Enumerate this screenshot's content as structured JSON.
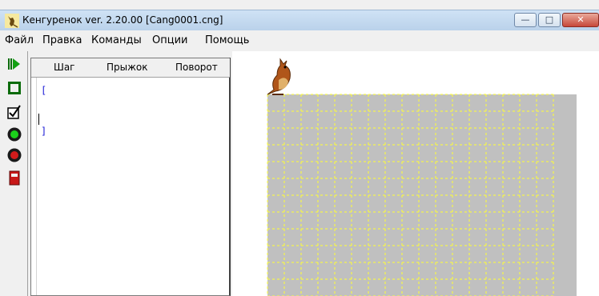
{
  "window": {
    "title": "Кенгуренок ver. 2.20.00  [Cang0001.cng]",
    "controls": {
      "minimize": "—",
      "maximize": "□",
      "close": "✕"
    }
  },
  "menu": [
    {
      "label": "Файл"
    },
    {
      "label": "Правка"
    },
    {
      "label": "Команды"
    },
    {
      "label": "Опции"
    },
    {
      "label": "Помощь"
    }
  ],
  "toolbar": {
    "items": [
      {
        "icon": "run-icon"
      },
      {
        "icon": "stop-square-icon"
      },
      {
        "icon": "check-edit-icon"
      },
      {
        "icon": "green-circle-icon"
      },
      {
        "icon": "red-circle-icon"
      },
      {
        "icon": "exit-door-icon"
      }
    ]
  },
  "editor": {
    "commands": [
      "Шаг",
      "Прыжок",
      "Поворот"
    ],
    "lines": [
      "[",
      "",
      "",
      "]"
    ]
  },
  "colors": {
    "field_background": "#c0c0c0",
    "grid_lines": "#ffff33",
    "code_text": "#1b1bd6"
  }
}
